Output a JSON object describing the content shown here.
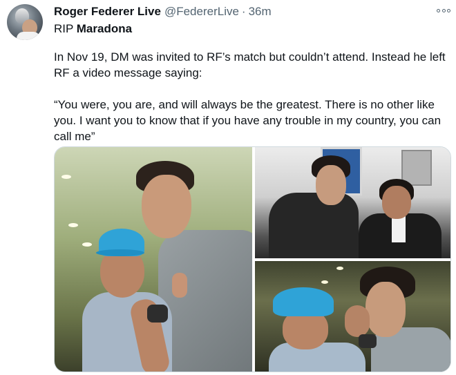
{
  "tweet": {
    "author_name": "Roger Federer Live",
    "author_handle": "@FedererLive",
    "separator": "·",
    "timestamp": "36m",
    "line1_prefix": "RIP ",
    "line1_bold": "Maradona",
    "paragraph1": "In Nov 19, DM was invited to RF’s match but couldn’t attend. Instead he left RF a video message saying:",
    "paragraph2": "“You were, you are, and will always be the greatest. There is no other like you. I want you to know that if you have any trouble in my country, you can call me”"
  },
  "icons": {
    "more": "more-options-icon",
    "avatar": "profile-avatar"
  },
  "colors": {
    "text": "#0f1419",
    "secondary": "#536471",
    "border": "#cfd9de",
    "cap_blue": "#2fa3d7"
  },
  "media": {
    "count": 3
  }
}
